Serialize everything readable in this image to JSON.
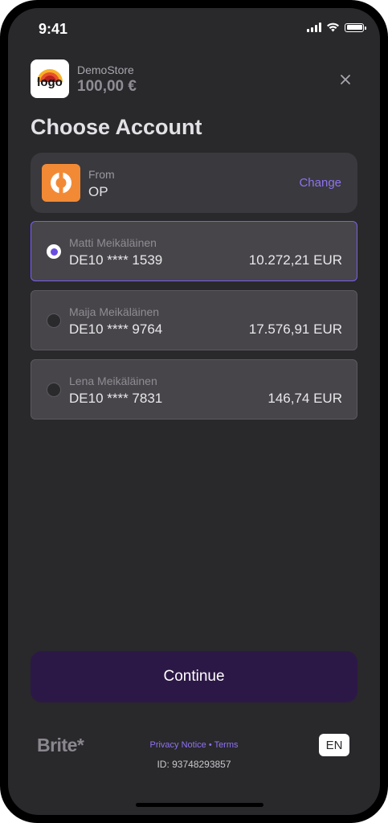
{
  "status_bar": {
    "time": "9:41"
  },
  "merchant": {
    "name": "DemoStore",
    "amount": "100,00 €",
    "logo_text": "logo"
  },
  "page_title": "Choose Account",
  "bank": {
    "from_label": "From",
    "name": "OP",
    "change_label": "Change",
    "logo_color": "#f28a35"
  },
  "accounts": [
    {
      "holder": "Matti Meikäläinen",
      "number": "DE10 **** 1539",
      "balance": "10.272,21 EUR",
      "selected": true
    },
    {
      "holder": "Maija Meikäläinen",
      "number": "DE10 **** 9764",
      "balance": "17.576,91 EUR",
      "selected": false
    },
    {
      "holder": "Lena Meikäläinen",
      "number": "DE10 **** 7831",
      "balance": "146,74 EUR",
      "selected": false
    }
  ],
  "continue_label": "Continue",
  "footer": {
    "brand": "Brite*",
    "privacy_label": "Privacy Notice",
    "separator": "•",
    "terms_label": "Terms",
    "id_text": "ID: 93748293857",
    "language": "EN"
  },
  "colors": {
    "accent": "#8f73f0",
    "selected_border": "#7a5ef0",
    "button_bg": "#2c1846",
    "background": "#29282b"
  }
}
